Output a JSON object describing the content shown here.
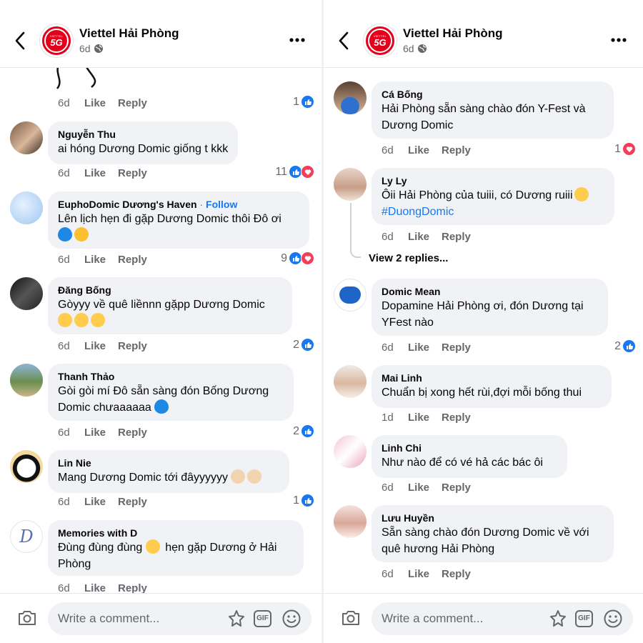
{
  "header": {
    "page_name": "Viettel Hải Phòng",
    "time": "6d",
    "logo_text": "5G",
    "logo_small": "VIETTEL"
  },
  "composer": {
    "placeholder": "Write a comment...",
    "gif_label": "GIF"
  },
  "labels": {
    "like": "Like",
    "reply": "Reply",
    "follow": "Follow",
    "view_replies": "View 2 replies..."
  },
  "left": {
    "top_partial": {
      "time": "6d",
      "reactions": "1"
    },
    "comments": [
      {
        "author": "Nguyễn Thu",
        "text": "ai hóng Dương Domic giống t kkk",
        "time": "6d",
        "reactions": "11"
      },
      {
        "author": "EuphoDomic Dương's Haven",
        "follow": "Follow",
        "text": "Lên lịch hẹn đi gặp Dương Domic thôi Đô ơi",
        "time": "6d",
        "reactions": "9"
      },
      {
        "author": "Đăng Bống",
        "text": "Gòyyy về quê liềnnn gặpp Dương Domic",
        "time": "6d",
        "reactions": "2"
      },
      {
        "author": "Thanh Thảo",
        "text1": "Gòi gòi mí Đô sẵn sàng đón Bống Dương",
        "text2": "Domic chưaaaaaa",
        "time": "6d",
        "reactions": "2"
      },
      {
        "author": "Lin Nie",
        "text": "Mang Dương Domic tới đâyyyyyy",
        "time": "6d",
        "reactions": "1"
      },
      {
        "author": "Memories with D",
        "text1": "Đùng đùng đùng",
        "text1b": "hẹn gặp Dương ở Hải",
        "text2": "Phòng",
        "time": "6d"
      }
    ]
  },
  "right": {
    "comments": [
      {
        "author": "Cá Bống",
        "text1": "Hải Phòng sẵn sàng chào đón Y-Fest và",
        "text2": "Dương Domic",
        "time": "6d",
        "reactions": "1"
      },
      {
        "author": "Ly Ly",
        "text1": "Ôii Hải Phòng của tuiii, có Dương ruiii",
        "hashtag": "#DuongDomic",
        "time": "6d"
      },
      {
        "author": "Domic Mean",
        "text1": "Dopamine Hải Phòng ơi, đón Dương tại",
        "text2": "YFest nào",
        "time": "6d",
        "reactions": "2"
      },
      {
        "author": "Mai Linh",
        "text": "Chuẩn bị xong hết rùi,đợi mỗi bống thui",
        "time": "1d"
      },
      {
        "author": "Linh Chi",
        "text": "Như nào để có vé hả các bác ôi",
        "time": "6d"
      },
      {
        "author": "Lưu Huyền",
        "text1": "Sẵn sàng chào đón Dương Domic về với",
        "text2": "quê hương Hải Phòng",
        "time": "6d"
      }
    ]
  },
  "colors": {
    "brand": "#e2001a",
    "link": "#1877f2",
    "love": "#f33e58",
    "bubble": "#f0f2f5"
  }
}
